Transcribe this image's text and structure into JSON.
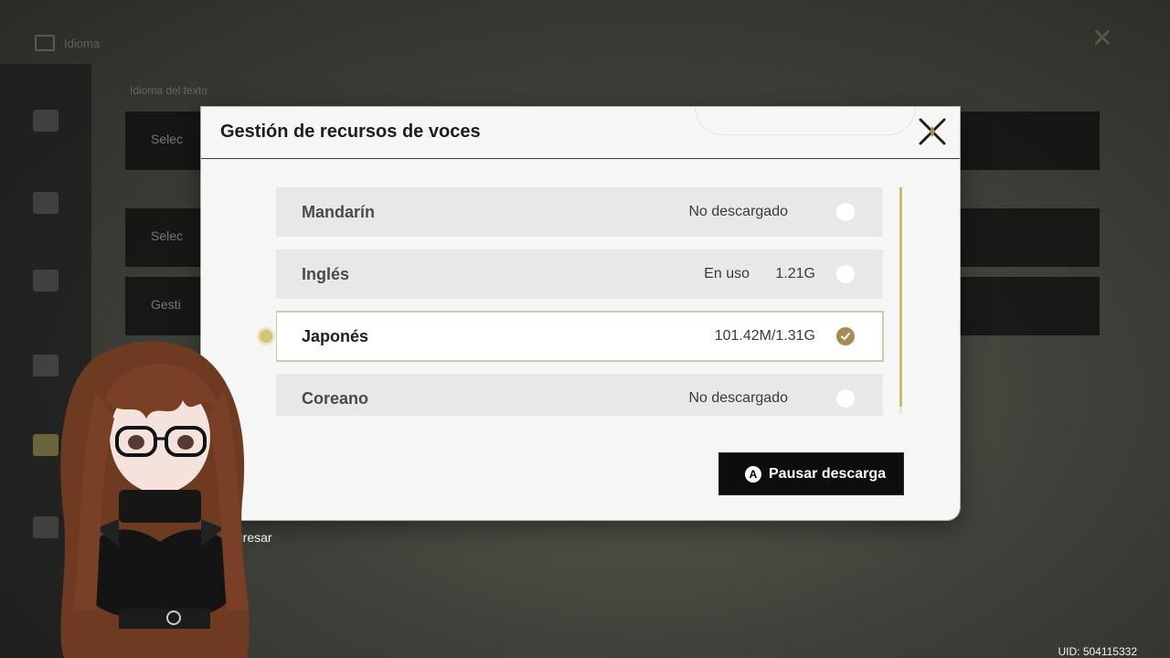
{
  "background": {
    "topbar_label": "Idioma",
    "caption": "Idioma del texto",
    "row_labels": [
      "Selec",
      "Selec",
      "Gesti"
    ],
    "back_label": "Regresar",
    "uid": "UID: 504115332"
  },
  "modal": {
    "title": "Gestión de recursos de voces",
    "languages": [
      {
        "name": "Mandarín",
        "status": "No descargado",
        "size": "",
        "selected": false
      },
      {
        "name": "Inglés",
        "status": "En uso",
        "size": "1.21G",
        "selected": false
      },
      {
        "name": "Japonés",
        "status": "",
        "size": "101.42M/1.31G",
        "selected": true
      },
      {
        "name": "Coreano",
        "status": "No descargado",
        "size": "",
        "selected": false
      }
    ],
    "pause_button_icon": "A",
    "pause_button_label": "Pausar descarga"
  },
  "colors": {
    "accent_gold": "#a88b52",
    "scroll_gold": "#cdbb6b",
    "button_bg": "#0d0d0d"
  }
}
